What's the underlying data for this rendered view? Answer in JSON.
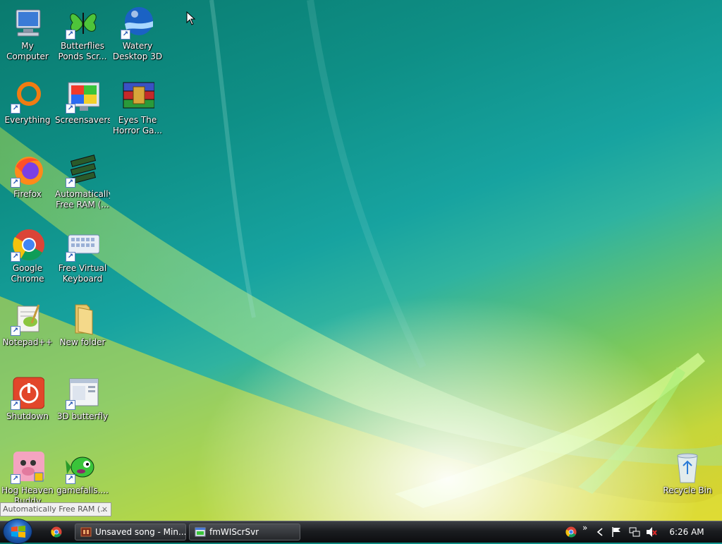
{
  "desktop": {
    "icons": [
      {
        "label": "My Computer"
      },
      {
        "label": "Butterflies\nPonds Scr..."
      },
      {
        "label": "Watery\nDesktop 3D"
      },
      {
        "label": "Everything"
      },
      {
        "label": "Screensavers"
      },
      {
        "label": "Eyes The\nHorror Ga..."
      },
      {
        "label": "Firefox"
      },
      {
        "label": "Automatically\nFree RAM (..."
      },
      {
        "label": "Google\nChrome"
      },
      {
        "label": "Free Virtual\nKeyboard"
      },
      {
        "label": "Notepad++"
      },
      {
        "label": "New folder"
      },
      {
        "label": "Shutdown"
      },
      {
        "label": "3D butterfly"
      },
      {
        "label": "Hog Heaven\nBuddy Page..."
      },
      {
        "label": "gamefalls...."
      },
      {
        "label": "Recycle Bin"
      }
    ],
    "tooltip": {
      "text": "Automatically Free RAM (...",
      "close": "×"
    }
  },
  "taskbar": {
    "tasks": [
      {
        "label": "Unsaved song - Min..."
      },
      {
        "label": "fmWIScrSvr"
      }
    ],
    "tray": {
      "overflow": "»",
      "clock": "6:26 AM"
    }
  },
  "colors": {
    "taskbar": "#1b1d20",
    "start_orb": "#1f5fb7"
  }
}
